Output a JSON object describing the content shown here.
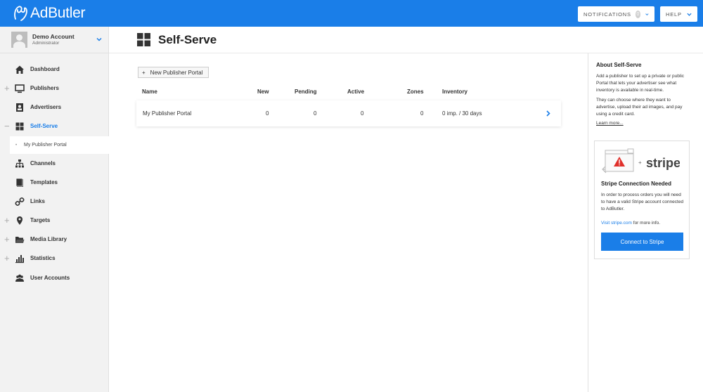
{
  "app": {
    "logo_text": "AdButler"
  },
  "topbar": {
    "notifications_label": "NOTIFICATIONS",
    "notifications_count": "0",
    "help_label": "HELP"
  },
  "account": {
    "name": "Demo Account",
    "role": "Administrator"
  },
  "sidebar": {
    "items": [
      {
        "label": "Dashboard",
        "icon": "home-icon",
        "expandable": false
      },
      {
        "label": "Publishers",
        "icon": "monitor-icon",
        "expandable": true
      },
      {
        "label": "Advertisers",
        "icon": "contacts-icon",
        "expandable": false
      },
      {
        "label": "Self-Serve",
        "icon": "grid-icon",
        "expandable": true,
        "active": true
      },
      {
        "label": "Channels",
        "icon": "hierarchy-icon",
        "expandable": false
      },
      {
        "label": "Templates",
        "icon": "document-icon",
        "expandable": false
      },
      {
        "label": "Links",
        "icon": "link-icon",
        "expandable": false
      },
      {
        "label": "Targets",
        "icon": "location-pin-icon",
        "expandable": true
      },
      {
        "label": "Media Library",
        "icon": "folder-icon",
        "expandable": true
      },
      {
        "label": "Statistics",
        "icon": "bar-chart-icon",
        "expandable": true
      },
      {
        "label": "User Accounts",
        "icon": "users-icon",
        "expandable": false
      }
    ],
    "sub_item": "My Publisher Portal"
  },
  "page": {
    "title": "Self-Serve",
    "new_button": "New Publisher Portal"
  },
  "table": {
    "headers": [
      "Name",
      "New",
      "Pending",
      "Active",
      "Zones",
      "Inventory"
    ],
    "rows": [
      {
        "name": "My Publisher Portal",
        "new": "0",
        "pending": "0",
        "active": "0",
        "zones": "0",
        "inventory": "0 imp. / 30 days"
      }
    ]
  },
  "about": {
    "title": "About Self-Serve",
    "p1": "Add a publisher to set up a private or public Portal that lets your advertiser see what inventory is available in real-time.",
    "p2": "They can choose where they want to advertise, upload their ad images, and pay using a credit card.",
    "learn_more": "Learn more..."
  },
  "stripe": {
    "brand": "stripe",
    "title": "Stripe Connection Needed",
    "body": "In order to process orders you will need to have a valid Stripe account connected to AdButler.",
    "link": "Visit stripe.com",
    "link_suffix": " for more info.",
    "button": "Connect to Stripe"
  },
  "colors": {
    "brand_blue": "#1a7ee8",
    "warning_red": "#e0302b"
  }
}
